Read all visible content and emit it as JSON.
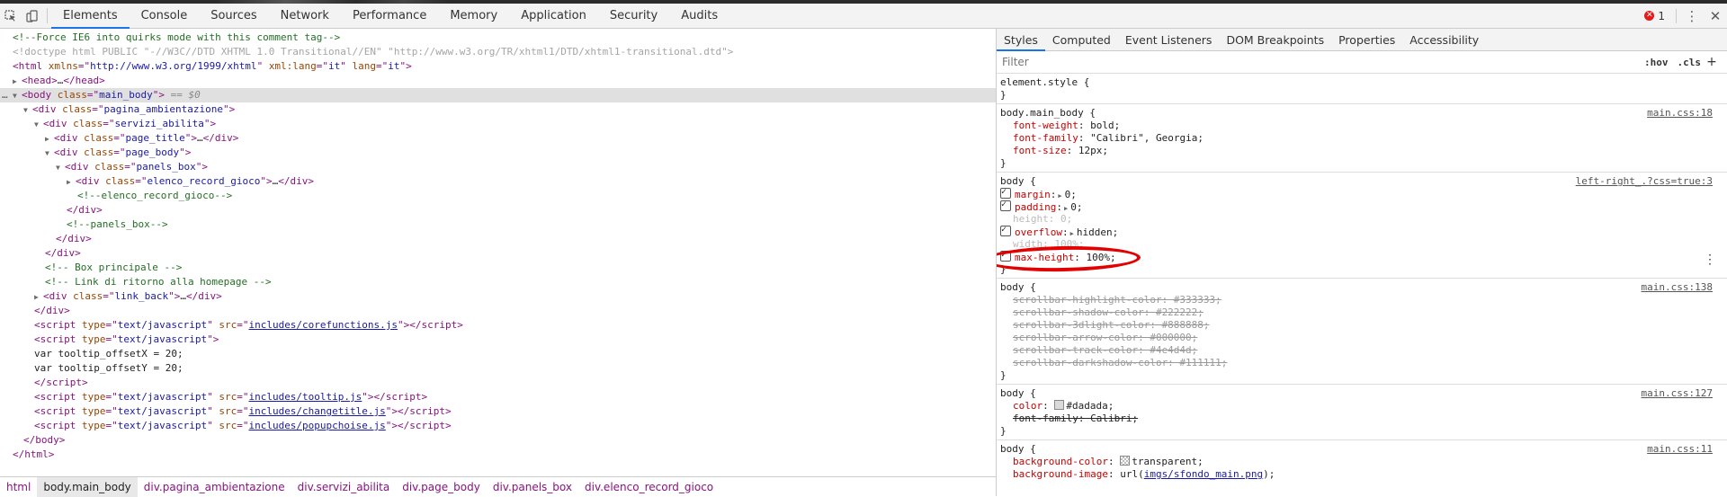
{
  "toolbar": {
    "tabs": [
      "Elements",
      "Console",
      "Sources",
      "Network",
      "Performance",
      "Memory",
      "Application",
      "Security",
      "Audits"
    ],
    "active_tab": "Elements",
    "error_count": "1"
  },
  "dom": {
    "l1": "<!--Force IE6 into quirks mode with this comment tag-->",
    "l2": "<!doctype html PUBLIC \"-//W3C//DTD XHTML 1.0 Transitional//EN\" \"http://www.w3.org/TR/xhtml1/DTD/xhtml1-transitional.dtd\">",
    "html_xmlns": "http://www.w3.org/1999/xhtml",
    "html_lang": "it",
    "body_class": "main_body",
    "body_eq": "== $0",
    "c_pagina": "pagina_ambientazione",
    "c_servizi": "servizi_abilita",
    "c_title": "page_title",
    "c_page_body": "page_body",
    "c_panels": "panels_box",
    "c_elenco": "elenco_record_gioco",
    "cm_elenco": "<!--elenco_record_gioco-->",
    "cm_panels": "<!--panels_box-->",
    "cm_box": "<!-- Box principale -->",
    "cm_link": "<!-- Link di ritorno alla homepage -->",
    "c_link_back": "link_back",
    "js_type": "text/javascript",
    "src_core": "includes/corefunctions.js",
    "var1": "var tooltip_offsetX = 20;",
    "var2": "var tooltip_offsetY = 20;",
    "src_tooltip": "includes/tooltip.js",
    "src_change": "includes/changetitle.js",
    "src_popup": "includes/popupchoise.js"
  },
  "breadcrumbs": [
    "html",
    "body.main_body",
    "div.pagina_ambientazione",
    "div.servizi_abilita",
    "div.page_body",
    "div.panels_box",
    "div.elenco_record_gioco"
  ],
  "styles": {
    "tabs": [
      "Styles",
      "Computed",
      "Event Listeners",
      "DOM Breakpoints",
      "Properties",
      "Accessibility"
    ],
    "filter_placeholder": "Filter",
    "hov": ":hov",
    "cls": ".cls",
    "element_style": "element.style {",
    "r1": {
      "selector": "body.main_body {",
      "source": "main.css:18",
      "p1n": "font-weight",
      "p1v": "bold;",
      "p2n": "font-family",
      "p2v": "\"Calibri\", Georgia;",
      "p3n": "font-size",
      "p3v": "12px;"
    },
    "r2": {
      "selector": "body {",
      "source": "left-right_.?css=true:3",
      "margin_n": "margin",
      "margin_v": "0;",
      "padding_n": "padding",
      "padding_v": "0;",
      "height_n": "height",
      "height_v": "0;",
      "overflow_n": "overflow",
      "overflow_v": "hidden;",
      "width_n": "width",
      "width_v": "100%;",
      "maxh_n": "max-height",
      "maxh_v": "100%;"
    },
    "r3": {
      "selector": "body {",
      "source": "main.css:138",
      "s1": "scrollbar-highlight-color: #333333;",
      "s2": "scrollbar-shadow-color: #222222;",
      "s3": "scrollbar-3dlight-color: #888888;",
      "s4": "scrollbar-arrow-color: #000000;",
      "s5": "scrollbar-track-color: #4e4d4d;",
      "s6": "scrollbar-darkshadow-color: #111111;"
    },
    "r4": {
      "selector": "body {",
      "source": "main.css:127",
      "color_n": "color",
      "color_v": "#dadada;",
      "ff": "font-family: Calibri;"
    },
    "r5": {
      "selector": "body {",
      "source": "main.css:11",
      "bg_n": "background-color",
      "bg_v": "transparent;",
      "bgi_n": "background-image",
      "bgi_url": "imgs/sfondo_main.png"
    },
    "brace": "}"
  },
  "colors": {
    "accent": "#1a73e8",
    "highlight_ring": "#e30000",
    "swatch_text": "#dadada"
  }
}
